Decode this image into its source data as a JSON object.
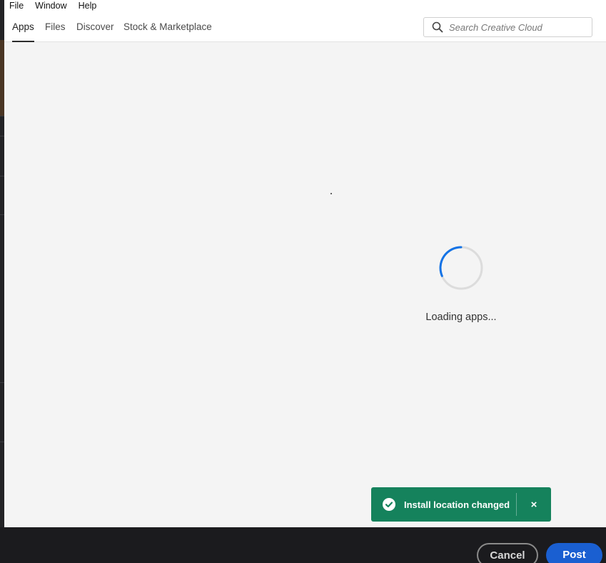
{
  "menubar": {
    "items": [
      "File",
      "Window",
      "Help"
    ]
  },
  "nav": {
    "tabs": [
      {
        "label": "Apps",
        "active": true
      },
      {
        "label": "Files",
        "active": false
      },
      {
        "label": "Discover",
        "active": false
      },
      {
        "label": "Stock & Marketplace",
        "active": false
      }
    ]
  },
  "search": {
    "placeholder": "Search Creative Cloud",
    "icon": "search-icon"
  },
  "loading": {
    "text": "Loading apps..."
  },
  "toast": {
    "message": "Install location changed",
    "close_label": "×",
    "color": "#15825c"
  },
  "footer": {
    "cancel_label": "Cancel",
    "post_label": "Post",
    "post_color": "#1a5fd1"
  }
}
